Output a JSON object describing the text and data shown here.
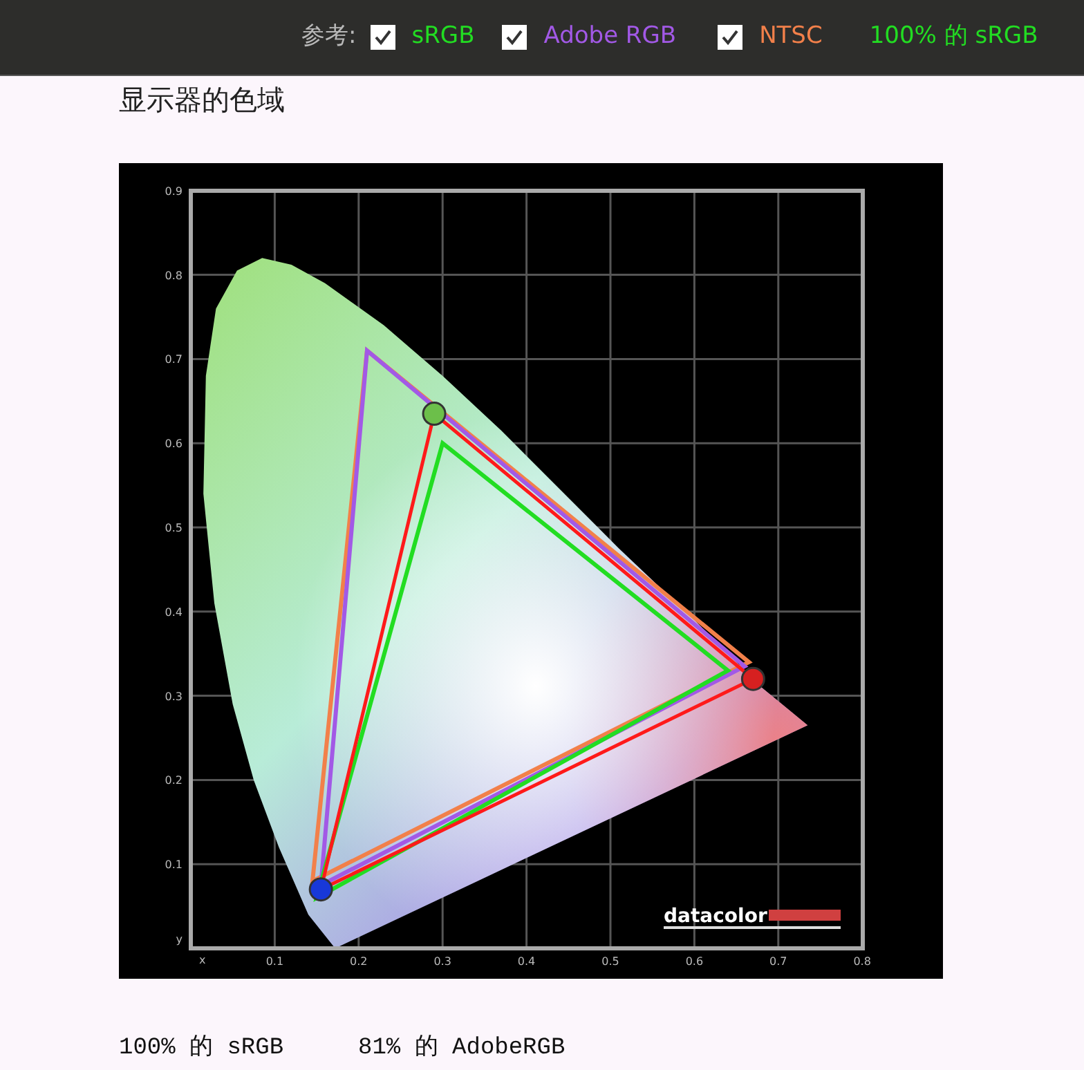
{
  "toolbar": {
    "label": "参考:",
    "references": [
      {
        "kind": "srgb",
        "label": "sRGB",
        "checked": true,
        "color": "#22dd22"
      },
      {
        "kind": "adobe",
        "label": "Adobe RGB",
        "checked": true,
        "color": "#a259e6"
      },
      {
        "kind": "ntsc",
        "label": "NTSC",
        "checked": true,
        "color": "#f2804a"
      }
    ],
    "result": "100% 的 sRGB"
  },
  "heading": "显示器的色域",
  "diagram": {
    "x_axis_label": "x",
    "y_axis_label": "y",
    "x_ticks": [
      "0.1",
      "0.2",
      "0.3",
      "0.4",
      "0.5",
      "0.6",
      "0.7",
      "0.8"
    ],
    "y_ticks": [
      "0.9",
      "0.8",
      "0.7",
      "0.6",
      "0.5",
      "0.4",
      "0.3",
      "0.2",
      "0.1"
    ],
    "logo": "datacolor"
  },
  "summary": [
    "100% 的 sRGB",
    "81% 的 AdobeRGB"
  ]
}
